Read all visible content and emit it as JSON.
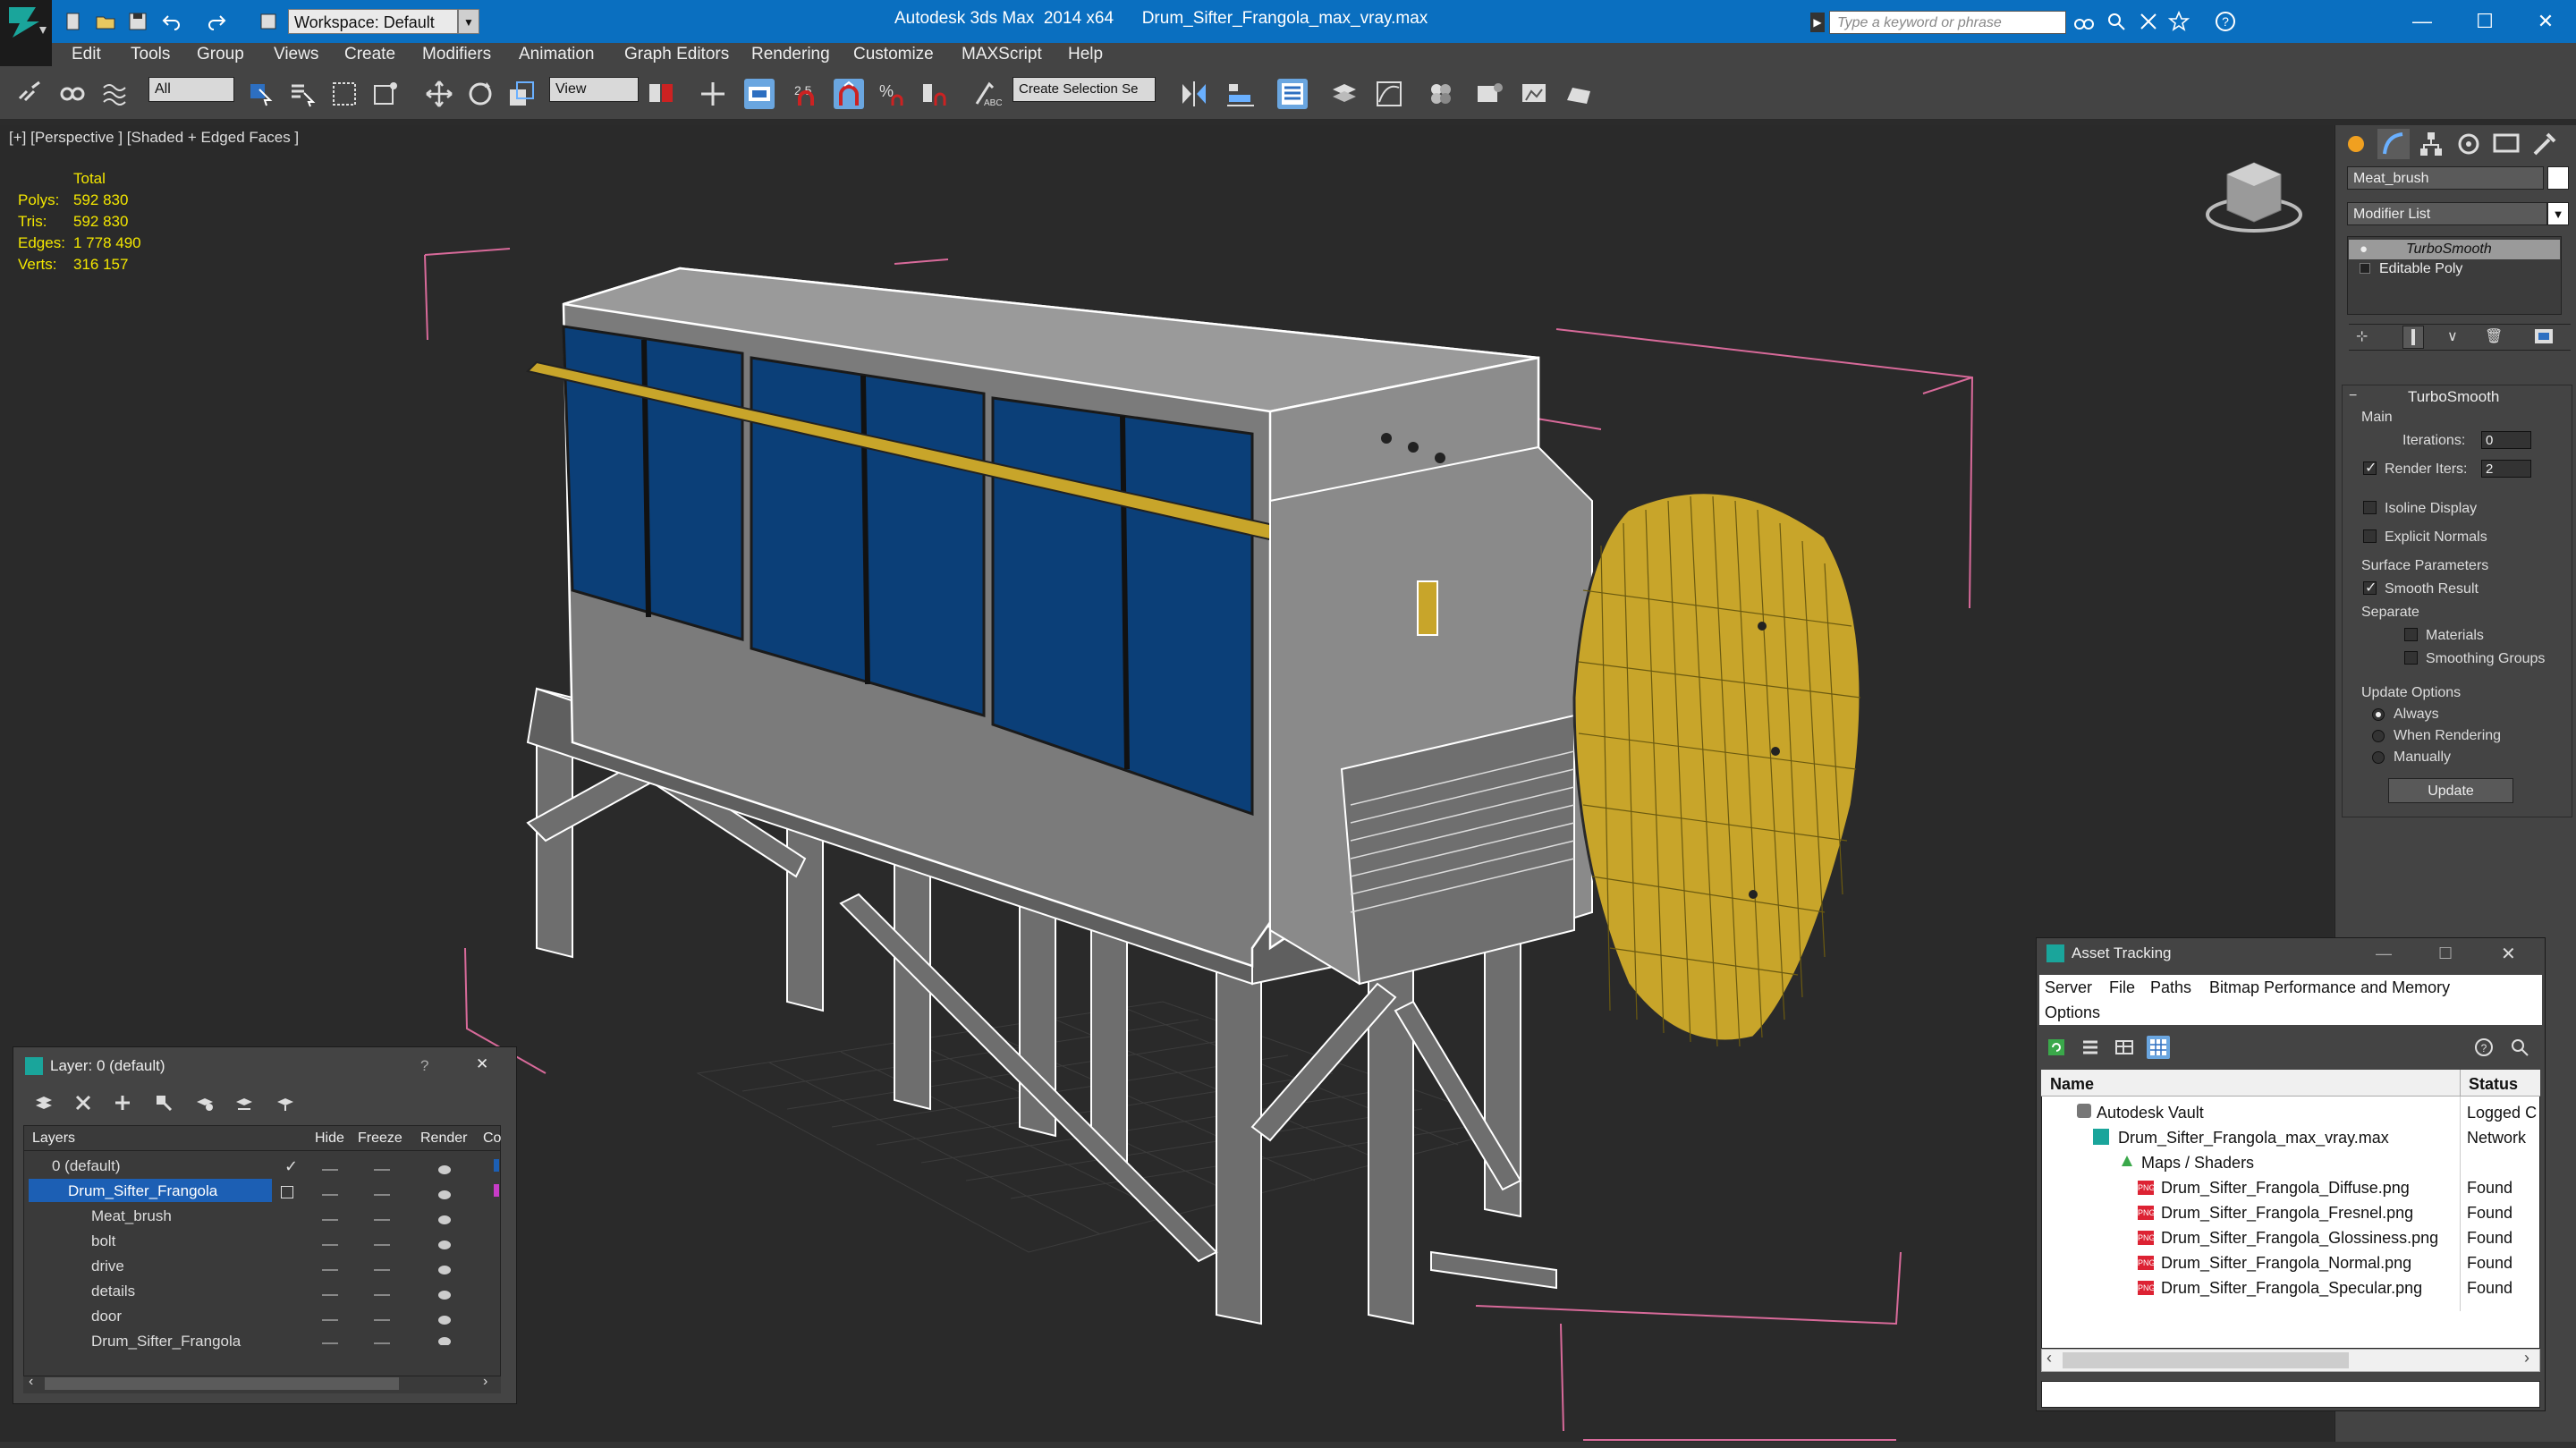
{
  "app": {
    "title": "Autodesk 3ds Max  2014 x64      Drum_Sifter_Frangola_max_vray.max",
    "workspace": "Workspace: Default",
    "search_placeholder": "Type a keyword or phrase",
    "window_controls": [
      "—",
      "☐",
      "✕"
    ]
  },
  "menu": [
    "Edit",
    "Tools",
    "Group",
    "Views",
    "Create",
    "Modifiers",
    "Animation",
    "Graph Editors",
    "Rendering",
    "Customize",
    "MAXScript",
    "Help"
  ],
  "toolbar": {
    "filter_value": "All",
    "refcoord_value": "View",
    "snap_label": "2.5",
    "named_selection_placeholder": "Create Selection Se"
  },
  "viewport": {
    "label": "[+] [Perspective ] [Shaded + Edged Faces ]",
    "stats_header": "Total",
    "stats": [
      {
        "label": "Polys:",
        "value": "592 830"
      },
      {
        "label": "Tris:",
        "value": "592 830"
      },
      {
        "label": "Edges:",
        "value": "1 778 490"
      },
      {
        "label": "Verts:",
        "value": "316 157"
      }
    ]
  },
  "command_panel": {
    "object_name": "Meat_brush",
    "modifier_list": "Modifier List",
    "stack": [
      "TurboSmooth",
      "Editable Poly"
    ],
    "turbosmooth": {
      "title": "TurboSmooth",
      "main_label": "Main",
      "iterations_label": "Iterations:",
      "iterations_value": "0",
      "render_iters_label": "Render Iters:",
      "render_iters_value": "2",
      "isoline": "Isoline Display",
      "explicit": "Explicit Normals",
      "surface_params": "Surface Parameters",
      "smooth_result": "Smooth Result",
      "separate": "Separate",
      "materials": "Materials",
      "smoothing_groups": "Smoothing Groups",
      "update_options": "Update Options",
      "always": "Always",
      "when_rendering": "When Rendering",
      "manually": "Manually",
      "update_button": "Update"
    }
  },
  "layer_window": {
    "title": "Layer: 0 (default)",
    "help": "?",
    "close": "✕",
    "columns": [
      "Layers",
      "Hide",
      "Freeze",
      "Render",
      "Co"
    ],
    "rows": [
      {
        "name": "0 (default)",
        "indent": 0
      },
      {
        "name": "Drum_Sifter_Frangola",
        "indent": 0
      },
      {
        "name": "Meat_brush",
        "indent": 1
      },
      {
        "name": "bolt",
        "indent": 1
      },
      {
        "name": "drive",
        "indent": 1
      },
      {
        "name": "details",
        "indent": 1
      },
      {
        "name": "door",
        "indent": 1
      },
      {
        "name": "Drum_Sifter_Frangola",
        "indent": 1
      }
    ]
  },
  "asset_tracking": {
    "title": "Asset Tracking",
    "menu": [
      "Server",
      "File",
      "Paths",
      "Bitmap Performance and Memory",
      "Options"
    ],
    "columns": [
      "Name",
      "Status"
    ],
    "rows": [
      {
        "name": "Autodesk Vault",
        "status": "Logged C"
      },
      {
        "name": "Drum_Sifter_Frangola_max_vray.max",
        "status": "Network"
      },
      {
        "name": "Maps / Shaders",
        "status": ""
      },
      {
        "name": "Drum_Sifter_Frangola_Diffuse.png",
        "status": "Found"
      },
      {
        "name": "Drum_Sifter_Frangola_Fresnel.png",
        "status": "Found"
      },
      {
        "name": "Drum_Sifter_Frangola_Glossiness.png",
        "status": "Found"
      },
      {
        "name": "Drum_Sifter_Frangola_Normal.png",
        "status": "Found"
      },
      {
        "name": "Drum_Sifter_Frangola_Specular.png",
        "status": "Found"
      }
    ]
  },
  "colors": {
    "titlebar": "#0a6fc0",
    "stats_text": "#f3e600",
    "selection": "#1c5fb4",
    "panel_blue": "#0b3f78",
    "mesh_gold": "#c8a52a"
  }
}
